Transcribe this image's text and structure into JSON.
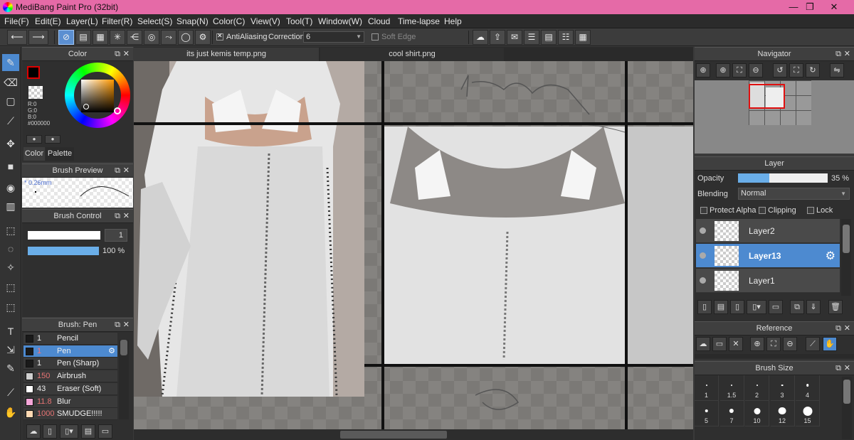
{
  "app": {
    "title": "MediBang Paint Pro (32bit)",
    "window_controls": [
      "—",
      "❐",
      "✕"
    ]
  },
  "menu": [
    "File(F)",
    "Edit(E)",
    "Layer(L)",
    "Filter(R)",
    "Select(S)",
    "Snap(N)",
    "Color(C)",
    "View(V)",
    "Tool(T)",
    "Window(W)",
    "Cloud",
    "Time-lapse",
    "Help"
  ],
  "toolbar": {
    "antialiasing_label": "AntiAliasing",
    "antialiasing_checked": true,
    "correction_label": "Correction",
    "correction_value": "6",
    "soft_edge_label": "Soft Edge",
    "soft_edge_checked": false
  },
  "color_panel": {
    "title": "Color",
    "r": "R:0",
    "g": "G:0",
    "b": "B:0",
    "hex": "#000000",
    "tab_color": "Color",
    "tab_palette": "Palette",
    "primary_color": "#000000",
    "accent": "#4d8ad0"
  },
  "brush_preview": {
    "title": "Brush Preview",
    "size_label": "* 0.26mm"
  },
  "brush_control": {
    "title": "Brush Control",
    "size_value": "1",
    "opacity_value": "100 %",
    "opacity": 1.0
  },
  "brush_list": {
    "title": "Brush: Pen",
    "items": [
      {
        "size": "1",
        "name": "Pencil",
        "color": "#1a1a1a",
        "selected": false
      },
      {
        "size": "1",
        "name": "Pen",
        "color": "#1a1a1a",
        "selected": true
      },
      {
        "size": "1",
        "name": "Pen (Sharp)",
        "color": "#1a1a1a",
        "selected": false
      },
      {
        "size": "150",
        "name": "Airbrush",
        "color": "#cfcfcf",
        "selected": false
      },
      {
        "size": "43",
        "name": "Eraser (Soft)",
        "color": "#ffffff",
        "selected": false
      },
      {
        "size": "11.8",
        "name": "Blur",
        "color": "#f4a6d8",
        "selected": false
      },
      {
        "size": "1000",
        "name": "SMUDGE!!!!!",
        "color": "#ffd9b3",
        "selected": false
      }
    ]
  },
  "documents": {
    "tabs": [
      "its just kemis temp.png",
      "cool shirt.png"
    ],
    "active_tab": 1
  },
  "navigator": {
    "title": "Navigator"
  },
  "layer_panel": {
    "title": "Layer",
    "opacity_label": "Opacity",
    "opacity_value": "35 %",
    "opacity": 0.35,
    "blending_label": "Blending",
    "blending_value": "Normal",
    "protect_alpha": "Protect Alpha",
    "clipping": "Clipping",
    "lock": "Lock",
    "layers": [
      {
        "name": "Layer2",
        "selected": false
      },
      {
        "name": "Layer13",
        "selected": true
      },
      {
        "name": "Layer1",
        "selected": false
      }
    ]
  },
  "reference_panel": {
    "title": "Reference"
  },
  "brush_size_panel": {
    "title": "Brush Size",
    "sizes_row1": [
      "1",
      "1.5",
      "2",
      "3",
      "4"
    ],
    "sizes_row2": [
      "5",
      "7",
      "10",
      "12",
      "15"
    ]
  }
}
